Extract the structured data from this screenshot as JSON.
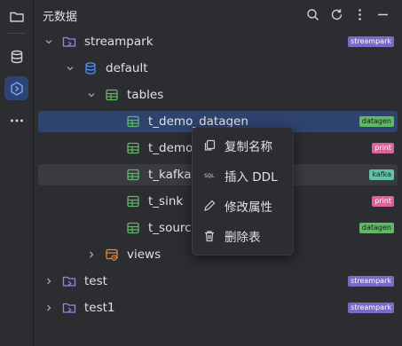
{
  "panel": {
    "title": "元数据"
  },
  "tree": [
    {
      "label": "streampark",
      "tag": "streampark"
    },
    {
      "label": "default"
    },
    {
      "label": "tables"
    },
    {
      "label": "t_demo_datagen",
      "tag": "datagen"
    },
    {
      "label": "t_demo_",
      "tag": "print"
    },
    {
      "label": "t_kafka",
      "tag": "kafka"
    },
    {
      "label": "t_sink",
      "tag": "print"
    },
    {
      "label": "t_source",
      "tag": "datagen"
    },
    {
      "label": "views"
    },
    {
      "label": "test",
      "tag": "streampark"
    },
    {
      "label": "test1",
      "tag": "streampark"
    }
  ],
  "context_menu": {
    "items": [
      {
        "label": "复制名称",
        "icon": "copy-icon"
      },
      {
        "label": "插入 DDL",
        "icon": "sql-icon",
        "icon_text": "SQL"
      },
      {
        "label": "修改属性",
        "icon": "edit-icon"
      },
      {
        "label": "删除表",
        "icon": "trash-icon"
      }
    ]
  },
  "colors": {
    "background": "#2b2d30",
    "selected_row": "#2e436e",
    "accent": "#3574f0",
    "tag_streampark": "#7b68c8",
    "tag_datagen": "#5fb865",
    "tag_print": "#e0609a",
    "tag_kafka": "#62c2a9"
  }
}
